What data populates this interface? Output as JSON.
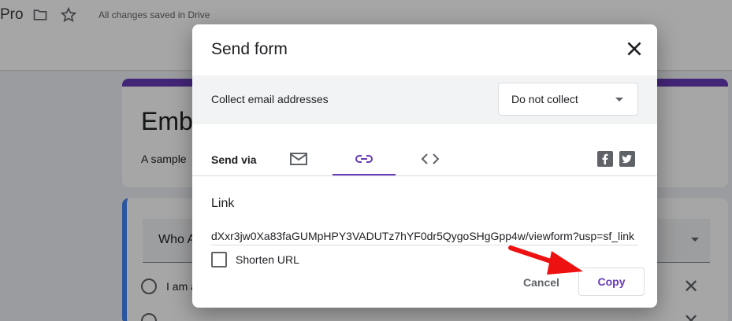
{
  "background": {
    "app_title": "Pro",
    "save_status": "All changes saved in Drive",
    "form_title": "Emb",
    "form_desc": "A sample",
    "question": "Who A",
    "options": [
      "I am a",
      ""
    ]
  },
  "dialog": {
    "title": "Send form",
    "collect_label": "Collect email addresses",
    "collect_value": "Do not collect",
    "send_via_label": "Send via",
    "tabs": [
      "email",
      "link",
      "embed"
    ],
    "active_tab": "link",
    "link_heading": "Link",
    "link_url": "dXxr3jw0Xa83faGUMpHPY3VADUTz7hYF0dr5QygoSHgGpp4w/viewform?usp=sf_link",
    "shorten_label": "Shorten URL",
    "shorten_checked": false,
    "cancel_label": "Cancel",
    "copy_label": "Copy"
  },
  "colors": {
    "accent": "#673ab7",
    "arrow": "#ee1111"
  }
}
